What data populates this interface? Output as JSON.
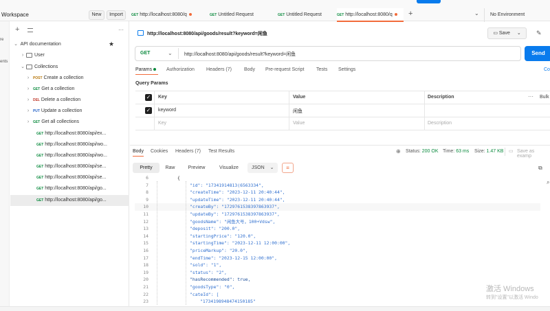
{
  "workspace": {
    "title": "Workspace",
    "new_label": "New",
    "import_label": "Import"
  },
  "tabs": [
    {
      "method": "GET",
      "label": "http://localhost:8080/q",
      "dirty": true
    },
    {
      "method": "GET",
      "label": "Untitled Request",
      "dirty": false
    },
    {
      "method": "GET",
      "label": "Untitled Request",
      "dirty": false
    },
    {
      "method": "GET",
      "label": "http://localhost:8080/q",
      "dirty": true,
      "active": true
    }
  ],
  "environment": {
    "label": "No Environment"
  },
  "sidebar": {
    "collection_name": "API documentation",
    "folders": [
      {
        "label": "User"
      },
      {
        "label": "Collections"
      }
    ],
    "requests": [
      {
        "method": "POST",
        "label": "Create a collection"
      },
      {
        "method": "GET",
        "label": "Get a collection"
      },
      {
        "method": "DEL",
        "label": "Delete a collection"
      },
      {
        "method": "PUT",
        "label": "Update a collection"
      },
      {
        "method": "GET",
        "label": "Get all collections"
      },
      {
        "method": "GET",
        "label": "http://localhost:8080/api/ex..."
      },
      {
        "method": "GET",
        "label": "http://localhost:8080/api/wo..."
      },
      {
        "method": "GET",
        "label": "http://localhost:8080/api/wo..."
      },
      {
        "method": "GET",
        "label": "http://localhost:8080/api/se..."
      },
      {
        "method": "GET",
        "label": "http://localhost:8080/api/se..."
      },
      {
        "method": "GET",
        "label": "http://localhost:8080/api/go..."
      },
      {
        "method": "GET",
        "label": "http://localhost:8080/api/go..."
      }
    ],
    "strip_labels": [
      "re",
      "ents"
    ]
  },
  "request": {
    "title": "http://localhost:8080/api/goods/result?keyword=闲鱼",
    "save_label": "Save",
    "method": "GET",
    "url": "http://localhost:8080/api/goods/result?keyword=闲鱼",
    "send_label": "Send",
    "cookies_label": "Co",
    "subtabs": [
      "Params",
      "Authorization",
      "Headers (7)",
      "Body",
      "Pre-request Script",
      "Tests",
      "Settings"
    ]
  },
  "params": {
    "section_title": "Query Params",
    "headers": {
      "key": "Key",
      "value": "Value",
      "description": "Description",
      "bulk": "Bulk"
    },
    "rows": [
      {
        "key": "keyword",
        "value": "闲鱼",
        "description": ""
      }
    ],
    "placeholder": {
      "key": "Key",
      "value": "Value",
      "description": "Description"
    }
  },
  "response": {
    "tabs": [
      "Body",
      "Cookies",
      "Headers (7)",
      "Test Results"
    ],
    "status_label": "Status:",
    "status_value": "200 OK",
    "time_label": "Time:",
    "time_value": "63 ms",
    "size_label": "Size:",
    "size_value": "1.47 KB",
    "save_label": "Save as examp",
    "views": [
      "Pretty",
      "Raw",
      "Preview",
      "Visualize"
    ],
    "format": "JSON",
    "lines": [
      {
        "n": "6",
        "text": "{"
      },
      {
        "n": "7",
        "text": "\"id\": \"17341914813(6563334\","
      },
      {
        "n": "8",
        "text": "\"createTime\": \"2023-12-11 20:40:44\","
      },
      {
        "n": "9",
        "text": "\"updateTime\": \"2023-12-11 20:40:44\","
      },
      {
        "n": "10",
        "text": "\"createBy\": \"1729761538397863937\","
      },
      {
        "n": "11",
        "text": "\"updateBy\": \"1729761538397863937\","
      },
      {
        "n": "12",
        "text": "\"goodsName\": \"闲鱼大号，100+Vdsw\","
      },
      {
        "n": "13",
        "text": "\"deposit\": \"200.0\","
      },
      {
        "n": "14",
        "text": "\"startingPrice\": \"120.0\","
      },
      {
        "n": "15",
        "text": "\"startingTime\": \"2023-12-11 12:00:00\","
      },
      {
        "n": "16",
        "text": "\"priceMarkup\": \"20.0\","
      },
      {
        "n": "17",
        "text": "\"endTime\": \"2023-12-15 12:00:00\","
      },
      {
        "n": "18",
        "text": "\"sold\": \"1\","
      },
      {
        "n": "19",
        "text": "\"status\": \"2\","
      },
      {
        "n": "20",
        "text": "\"hasRecommended\": true,"
      },
      {
        "n": "21",
        "text": "\"goodsType\": \"0\","
      },
      {
        "n": "22",
        "text": "\"cateId\": ["
      },
      {
        "n": "23",
        "text": "\"1734198948474150185\""
      }
    ]
  },
  "watermark": {
    "line1": "激活 Windows",
    "line2": "转到\"设置\"以激活 Windo"
  }
}
